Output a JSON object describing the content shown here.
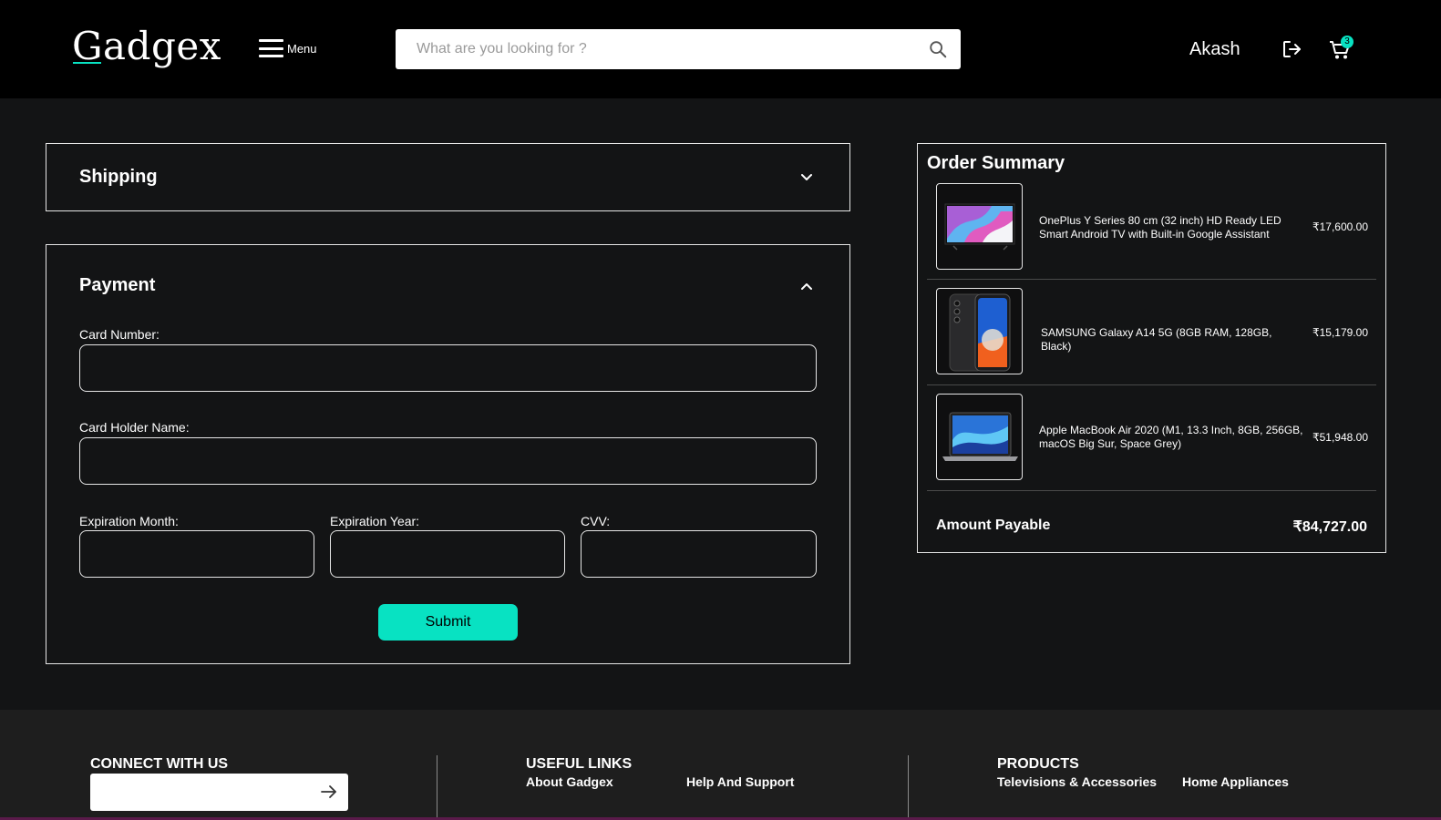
{
  "header": {
    "logo": "Gadgex",
    "menu_label": "Menu",
    "search_placeholder": "What are you looking for ?",
    "username": "Akash",
    "cart_count": "3"
  },
  "shipping": {
    "title": "Shipping"
  },
  "payment": {
    "title": "Payment",
    "card_number_label": "Card Number:",
    "card_holder_label": "Card Holder Name:",
    "exp_month_label": "Expiration Month:",
    "exp_year_label": "Expiration Year:",
    "cvv_label": "CVV:",
    "submit_label": "Submit"
  },
  "order_summary": {
    "title": "Order Summary",
    "items": [
      {
        "name": "OnePlus Y Series 80 cm (32 inch) HD Ready LED Smart Android TV with Built-in Google Assistant",
        "price": "₹17,600.00"
      },
      {
        "name": "SAMSUNG Galaxy A14 5G (8GB RAM, 128GB, Black)",
        "price": "₹15,179.00"
      },
      {
        "name": "Apple MacBook Air 2020 (M1, 13.3 Inch, 8GB, 256GB, macOS Big Sur, Space Grey)",
        "price": "₹51,948.00"
      }
    ],
    "amount_label": "Amount Payable",
    "amount_value": "₹84,727.00"
  },
  "footer": {
    "connect_heading": "CONNECT WITH US",
    "useful_heading": "USEFUL LINKS",
    "useful_links": [
      "About Gadgex",
      "Help And Support"
    ],
    "products_heading": "PRODUCTS",
    "product_links": [
      "Televisions & Accessories",
      "Home Appliances"
    ]
  },
  "colors": {
    "accent": "#08e2c2",
    "background": "#131415",
    "header": "#000000",
    "footer": "#1e1e1e"
  }
}
